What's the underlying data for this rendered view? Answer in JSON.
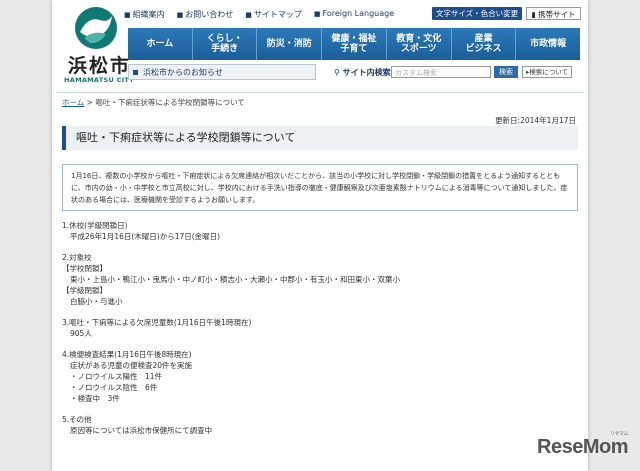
{
  "logo": {
    "jp": "浜松市",
    "en": "HAMAMATSU CITY"
  },
  "utility_links": [
    "組織案内",
    "お問い合わせ",
    "サイトマップ",
    "Foreign Language"
  ],
  "header_buttons": {
    "text_size": "文字サイズ・色合い変更",
    "mobile": "携帯サイト"
  },
  "nav": [
    {
      "label": "ホーム"
    },
    {
      "label": "くらし・\n手続き"
    },
    {
      "label": "防災・消防"
    },
    {
      "label": "健康・福祉\n子育て"
    },
    {
      "label": "教育・文化\nスポーツ"
    },
    {
      "label": "産業\nビジネス"
    },
    {
      "label": "市政情報"
    }
  ],
  "notice_link": "浜松市からのお知らせ",
  "search": {
    "label": "サイト内検索",
    "placeholder": "カスタム検索",
    "button": "検索",
    "howto": "検索について"
  },
  "breadcrumb": {
    "home": "ホーム",
    "separator": " > ",
    "current": "嘔吐・下痢症状等による学校閉鎖等について"
  },
  "updated": "更新日:2014年1月17日",
  "title": "嘔吐・下痢症状等による学校閉鎖等について",
  "intro": "1月16日、複数の小学校から嘔吐・下痢症状による欠席連絡が相次いだことから、該当の小学校に対し学校閉鎖・学級閉鎖の措置をとるよう通知するとともに、市内の幼・小・中学校と市立高校に対し、学校内における手洗い指導の徹底・健康観察及び次亜塩素酸ナトリウムによる消毒等について通知しました。症状のある場合には、医療機関を受診するようお願いします。",
  "sections": {
    "s1_title": "1.休校(学級閉鎖日)",
    "s1_line": "平成26年1月16日(木曜日)から17日(金曜日)",
    "s2_title": "2.対象校",
    "s2_sub1": "【学校閉鎖】",
    "s2_line1": "東小・上島小・鴨江小・曳馬小・中ノ町小・積志小・大瀬小・中郡小・有玉小・和田東小・双葉小",
    "s2_sub2": "【学級閉鎖】",
    "s2_line2": "白脇小・与進小",
    "s3_title": "3.嘔吐・下痢等による欠席児童数(1月16日午後1時現在)",
    "s3_line": "905人",
    "s4_title": "4.検便検査結果(1月16日午後8時現在)",
    "s4_line1": "症状がある児童の便検査20件を実施",
    "s4_line2": "・ノロウイルス陽性　11件",
    "s4_line3": "・ノロウイルス陰性　6件",
    "s4_line4": "・検査中　3件",
    "s5_title": "5.その他",
    "s5_line": "原因等については浜松市保健所にて調査中"
  },
  "watermark": {
    "main": "ReseMom",
    "sub": "リセマム"
  },
  "colors": {
    "nav_blue": "#1d4f8c",
    "logo_green": "#0d7a74",
    "link_blue": "#1a5bb0"
  }
}
